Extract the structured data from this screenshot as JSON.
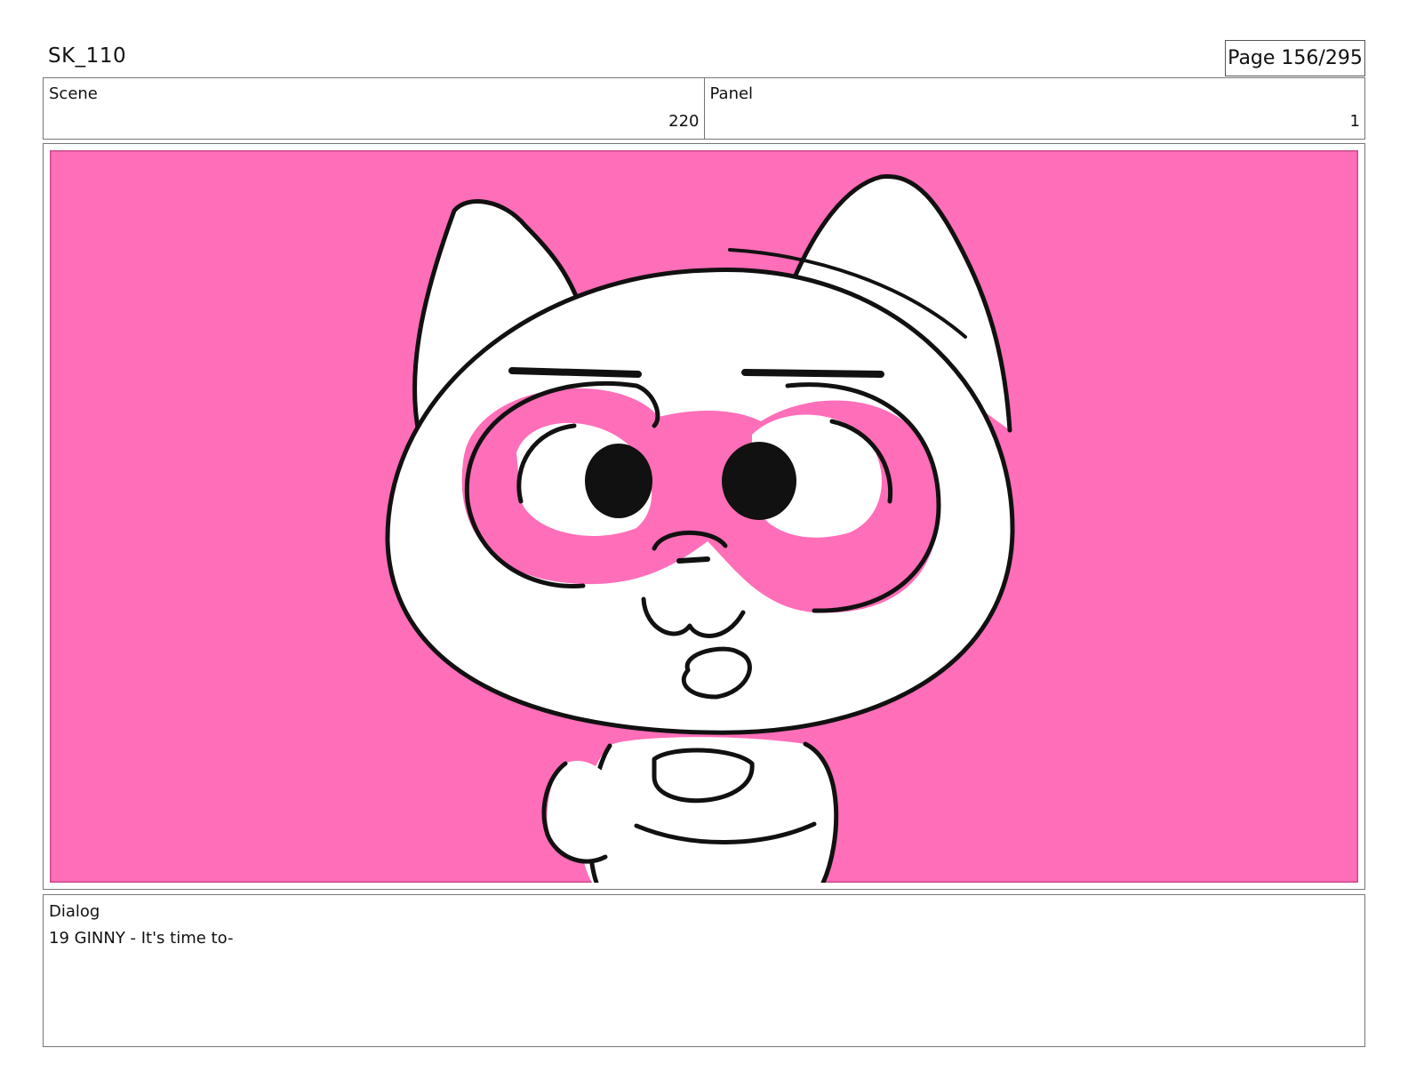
{
  "header": {
    "title": "SK_110",
    "page_label": "Page 156/295"
  },
  "scene": {
    "label": "Scene",
    "value": "220"
  },
  "panel": {
    "label": "Panel",
    "value": "1"
  },
  "artwork": {
    "subject": "cat-character-sketch-icon",
    "background_color": "#FF6EB8",
    "line_color": "#111111",
    "fill_color": "#FFFFFF"
  },
  "dialog": {
    "label": "Dialog",
    "text": "19 GINNY - It's time to-"
  }
}
